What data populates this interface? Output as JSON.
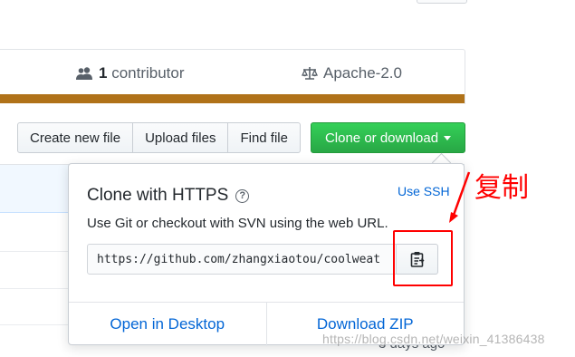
{
  "summary": {
    "contributors_count": "1",
    "contributors_label": "contributor",
    "license": "Apache-2.0",
    "language_color": "#b07219"
  },
  "toolbar": {
    "create_file": "Create new file",
    "upload_files": "Upload files",
    "find_file": "Find file",
    "clone_download": "Clone or download"
  },
  "clone_popup": {
    "title": "Clone with HTTPS",
    "help_icon": "question-icon",
    "use_ssh": "Use SSH",
    "description": "Use Git or checkout with SVN using the web URL.",
    "url": "https://github.com/zhangxiaotou/coolweat",
    "copy_icon": "clipboard-icon",
    "open_desktop": "Open in Desktop",
    "download_zip": "Download ZIP"
  },
  "annotation": {
    "label": "复制",
    "color": "#ff0000"
  },
  "background": {
    "partial_text": "3 days ago"
  },
  "watermark": "https://blog.csdn.net/weixin_41386438"
}
